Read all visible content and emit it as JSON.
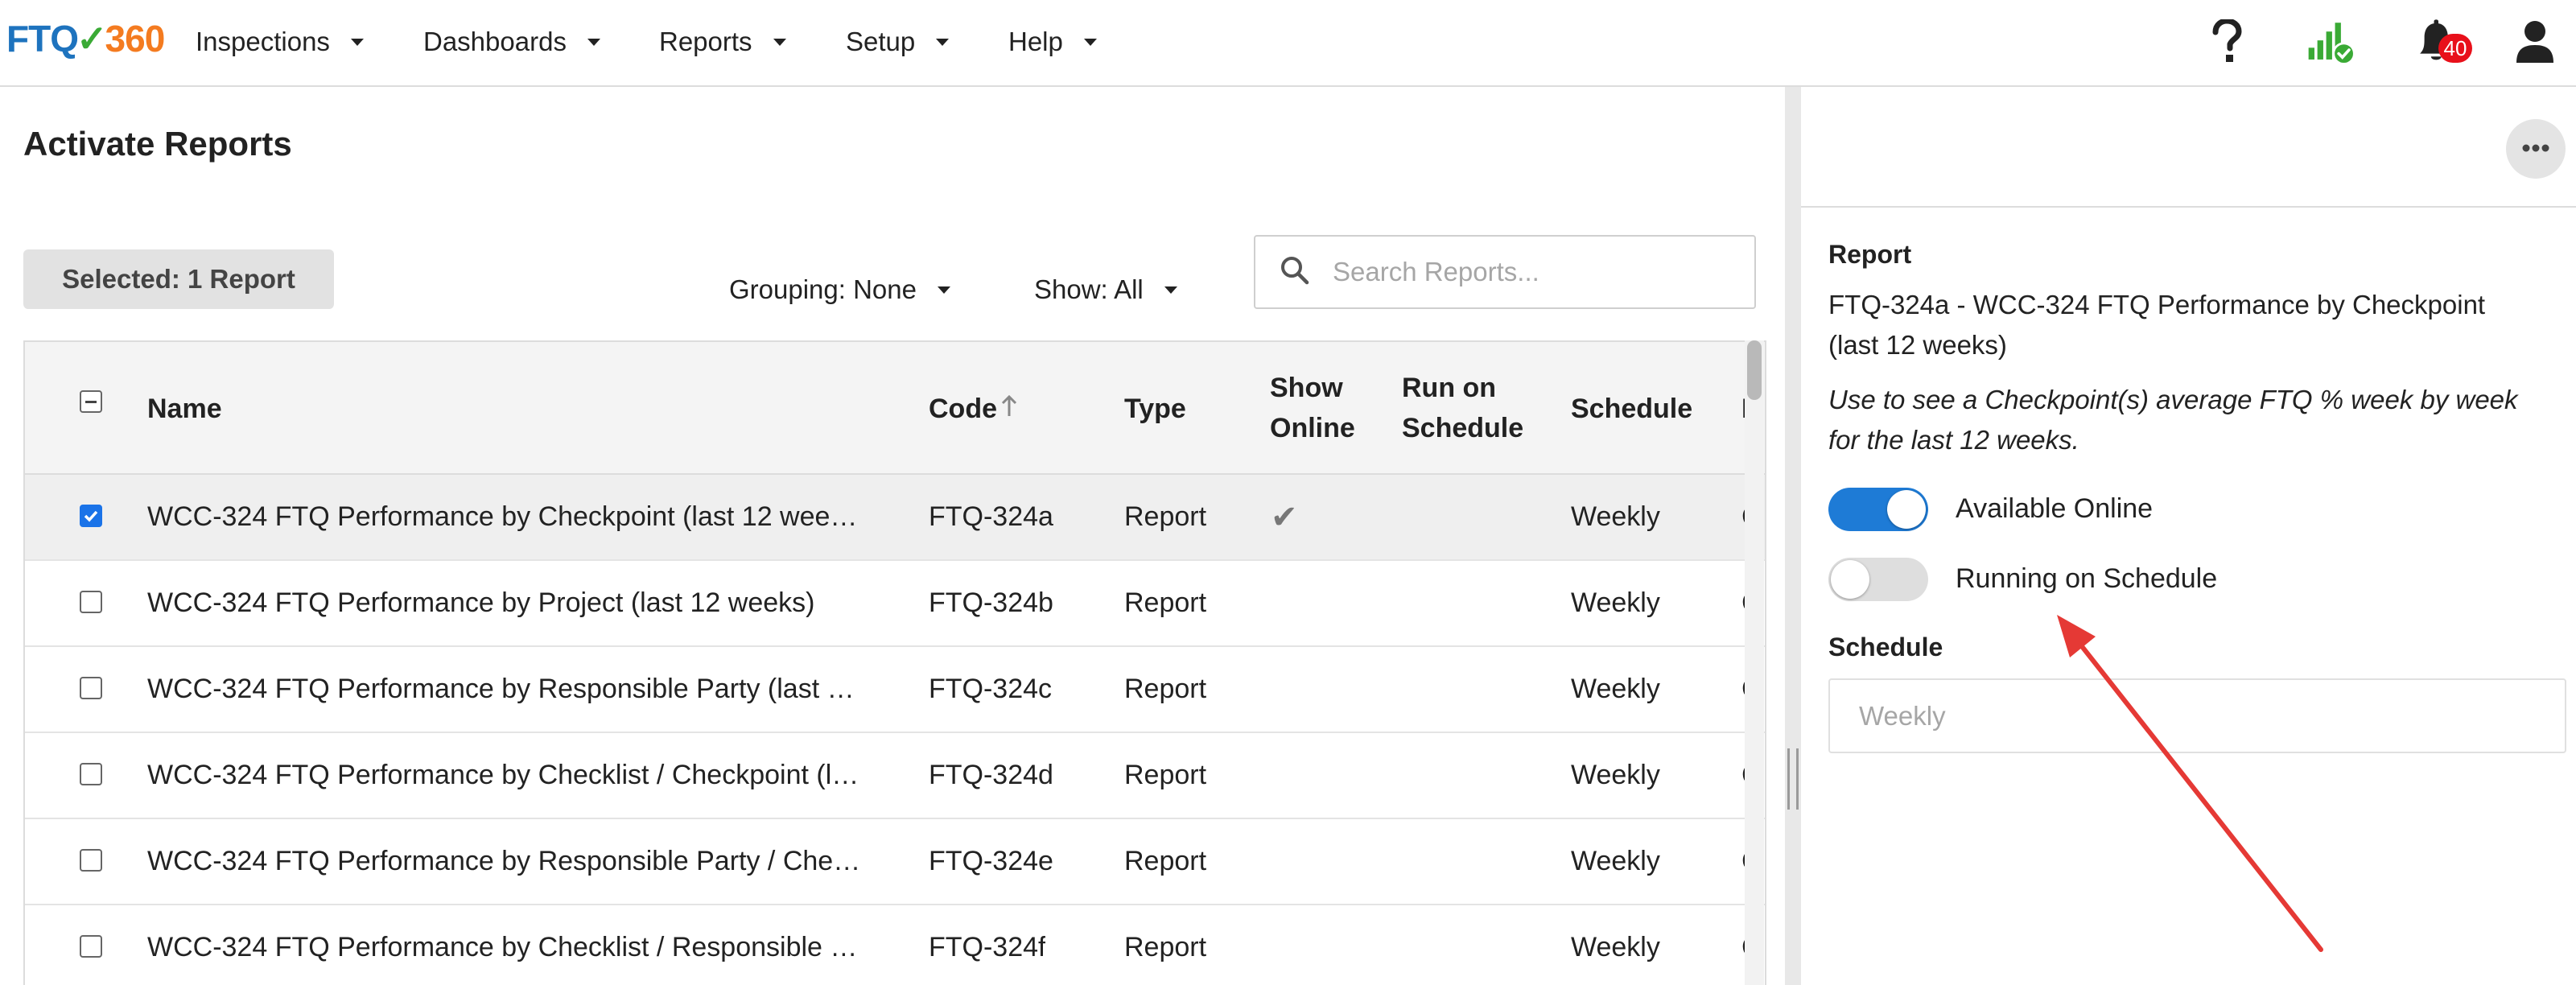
{
  "logo": {
    "part1": "FTQ",
    "check": "✓",
    "part2": "360"
  },
  "nav": [
    {
      "label": "Inspections"
    },
    {
      "label": "Dashboards"
    },
    {
      "label": "Reports"
    },
    {
      "label": "Setup"
    },
    {
      "label": "Help"
    }
  ],
  "header_icons": {
    "help": "question-icon",
    "signal": "signal-strength-icon",
    "notifications": "bell-icon",
    "notification_count": "40",
    "user": "user-icon"
  },
  "page": {
    "title": "Activate Reports",
    "selected_label": "Selected: 1 Report",
    "grouping_label": "Grouping: None",
    "show_label": "Show: All",
    "search_placeholder": "Search Reports..."
  },
  "table": {
    "columns": {
      "name": "Name",
      "code": "Code",
      "type": "Type",
      "show_online_1": "Show",
      "show_online_2": "Online",
      "run_on_schedule_1": "Run on",
      "run_on_schedule_2": "Schedule",
      "schedule": "Schedule",
      "cut": "L"
    },
    "rows": [
      {
        "name": "WCC-324 FTQ Performance by Checkpoint (last 12 wee…",
        "code": "FTQ-324a",
        "type": "Report",
        "online": "✔",
        "schedule": "Weekly",
        "cut": "C",
        "checked": true
      },
      {
        "name": "WCC-324 FTQ Performance by Project (last 12 weeks)",
        "code": "FTQ-324b",
        "type": "Report",
        "online": "",
        "schedule": "Weekly",
        "cut": "C",
        "checked": false
      },
      {
        "name": "WCC-324 FTQ Performance by Responsible Party (last …",
        "code": "FTQ-324c",
        "type": "Report",
        "online": "",
        "schedule": "Weekly",
        "cut": "C",
        "checked": false
      },
      {
        "name": "WCC-324 FTQ Performance by Checklist / Checkpoint (l…",
        "code": "FTQ-324d",
        "type": "Report",
        "online": "",
        "schedule": "Weekly",
        "cut": "C",
        "checked": false
      },
      {
        "name": "WCC-324 FTQ Performance by Responsible Party / Che…",
        "code": "FTQ-324e",
        "type": "Report",
        "online": "",
        "schedule": "Weekly",
        "cut": "C",
        "checked": false
      },
      {
        "name": "WCC-324 FTQ Performance by Checklist / Responsible …",
        "code": "FTQ-324f",
        "type": "Report",
        "online": "",
        "schedule": "Weekly",
        "cut": "C",
        "checked": false
      }
    ]
  },
  "detail": {
    "report_label": "Report",
    "report_title_line1": "FTQ-324a - WCC-324 FTQ Performance by Checkpoint",
    "report_title_line2": "(last 12 weeks)",
    "description_line1": "Use to see a Checkpoint(s) average FTQ % week by week",
    "description_line2": "for the last 12 weeks.",
    "available_online_label": "Available Online",
    "available_online": true,
    "running_on_schedule_label": "Running on Schedule",
    "running_on_schedule": false,
    "schedule_label": "Schedule",
    "schedule_placeholder": "Weekly"
  },
  "colors": {
    "brand_blue": "#1e73be",
    "brand_green": "#3aaa35",
    "brand_orange": "#f47b20",
    "toggle_on": "#1e7bd6",
    "checkbox_checked": "#1a73e8",
    "badge_red": "#e8101a",
    "arrow_red": "#e53935"
  }
}
